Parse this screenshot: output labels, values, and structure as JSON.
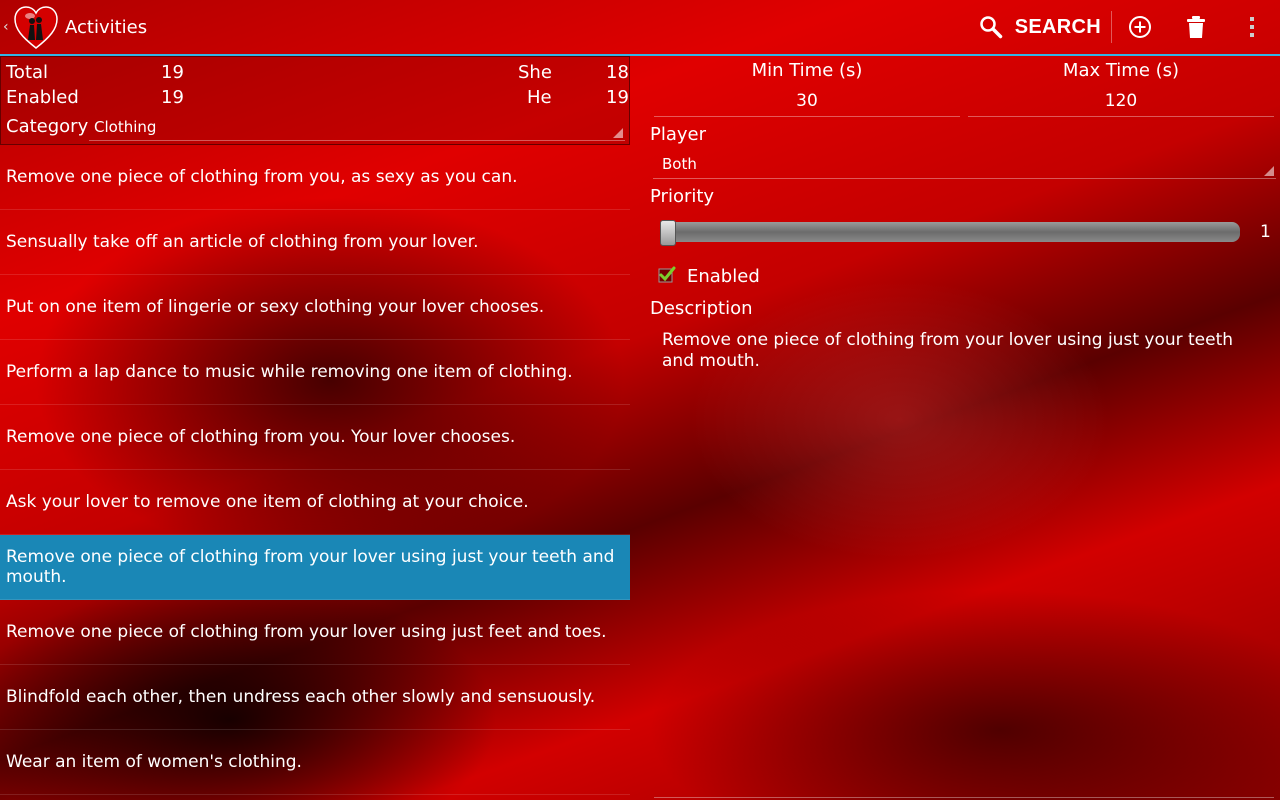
{
  "actionbar": {
    "title": "Activities",
    "search_label": "SEARCH"
  },
  "stats": {
    "total_label": "Total",
    "total_value": "19",
    "enabled_label": "Enabled",
    "enabled_value": "19",
    "she_label": "She",
    "she_value": "18",
    "he_label": "He",
    "he_value": "19",
    "category_label": "Category",
    "category_value": "Clothing"
  },
  "activities": [
    "Remove one piece of clothing from you, as sexy as you can.",
    "Sensually take off an article of clothing from your lover.",
    "Put on one item of lingerie or sexy clothing your lover chooses.",
    "Perform a lap dance to music while removing one item of clothing.",
    "Remove one piece of clothing from you. Your lover chooses.",
    "Ask your lover to remove one item of clothing at your choice.",
    "Remove one piece of clothing from your lover using just your teeth and mouth.",
    "Remove one piece of clothing from your lover using just feet and toes.",
    "Blindfold each other, then undress each other slowly and sensuously.",
    "Wear an item of women's clothing."
  ],
  "selected_index": 6,
  "detail": {
    "min_time_label": "Min Time (s)",
    "min_time_value": "30",
    "max_time_label": "Max Time (s)",
    "max_time_value": "120",
    "player_label": "Player",
    "player_value": "Both",
    "priority_label": "Priority",
    "priority_value": "1",
    "enabled_label": "Enabled",
    "enabled_checked": true,
    "description_label": "Description",
    "description_text": "Remove one piece of clothing from your lover using just your teeth and mouth."
  },
  "colors": {
    "accent": "#33b5e5",
    "selection": "#1a87b6",
    "background": "#cc0000"
  },
  "icons": [
    "back-caret-icon",
    "heart-couple-icon",
    "search-icon",
    "add-circle-icon",
    "trash-icon",
    "overflow-menu-icon",
    "checkmark-icon"
  ]
}
